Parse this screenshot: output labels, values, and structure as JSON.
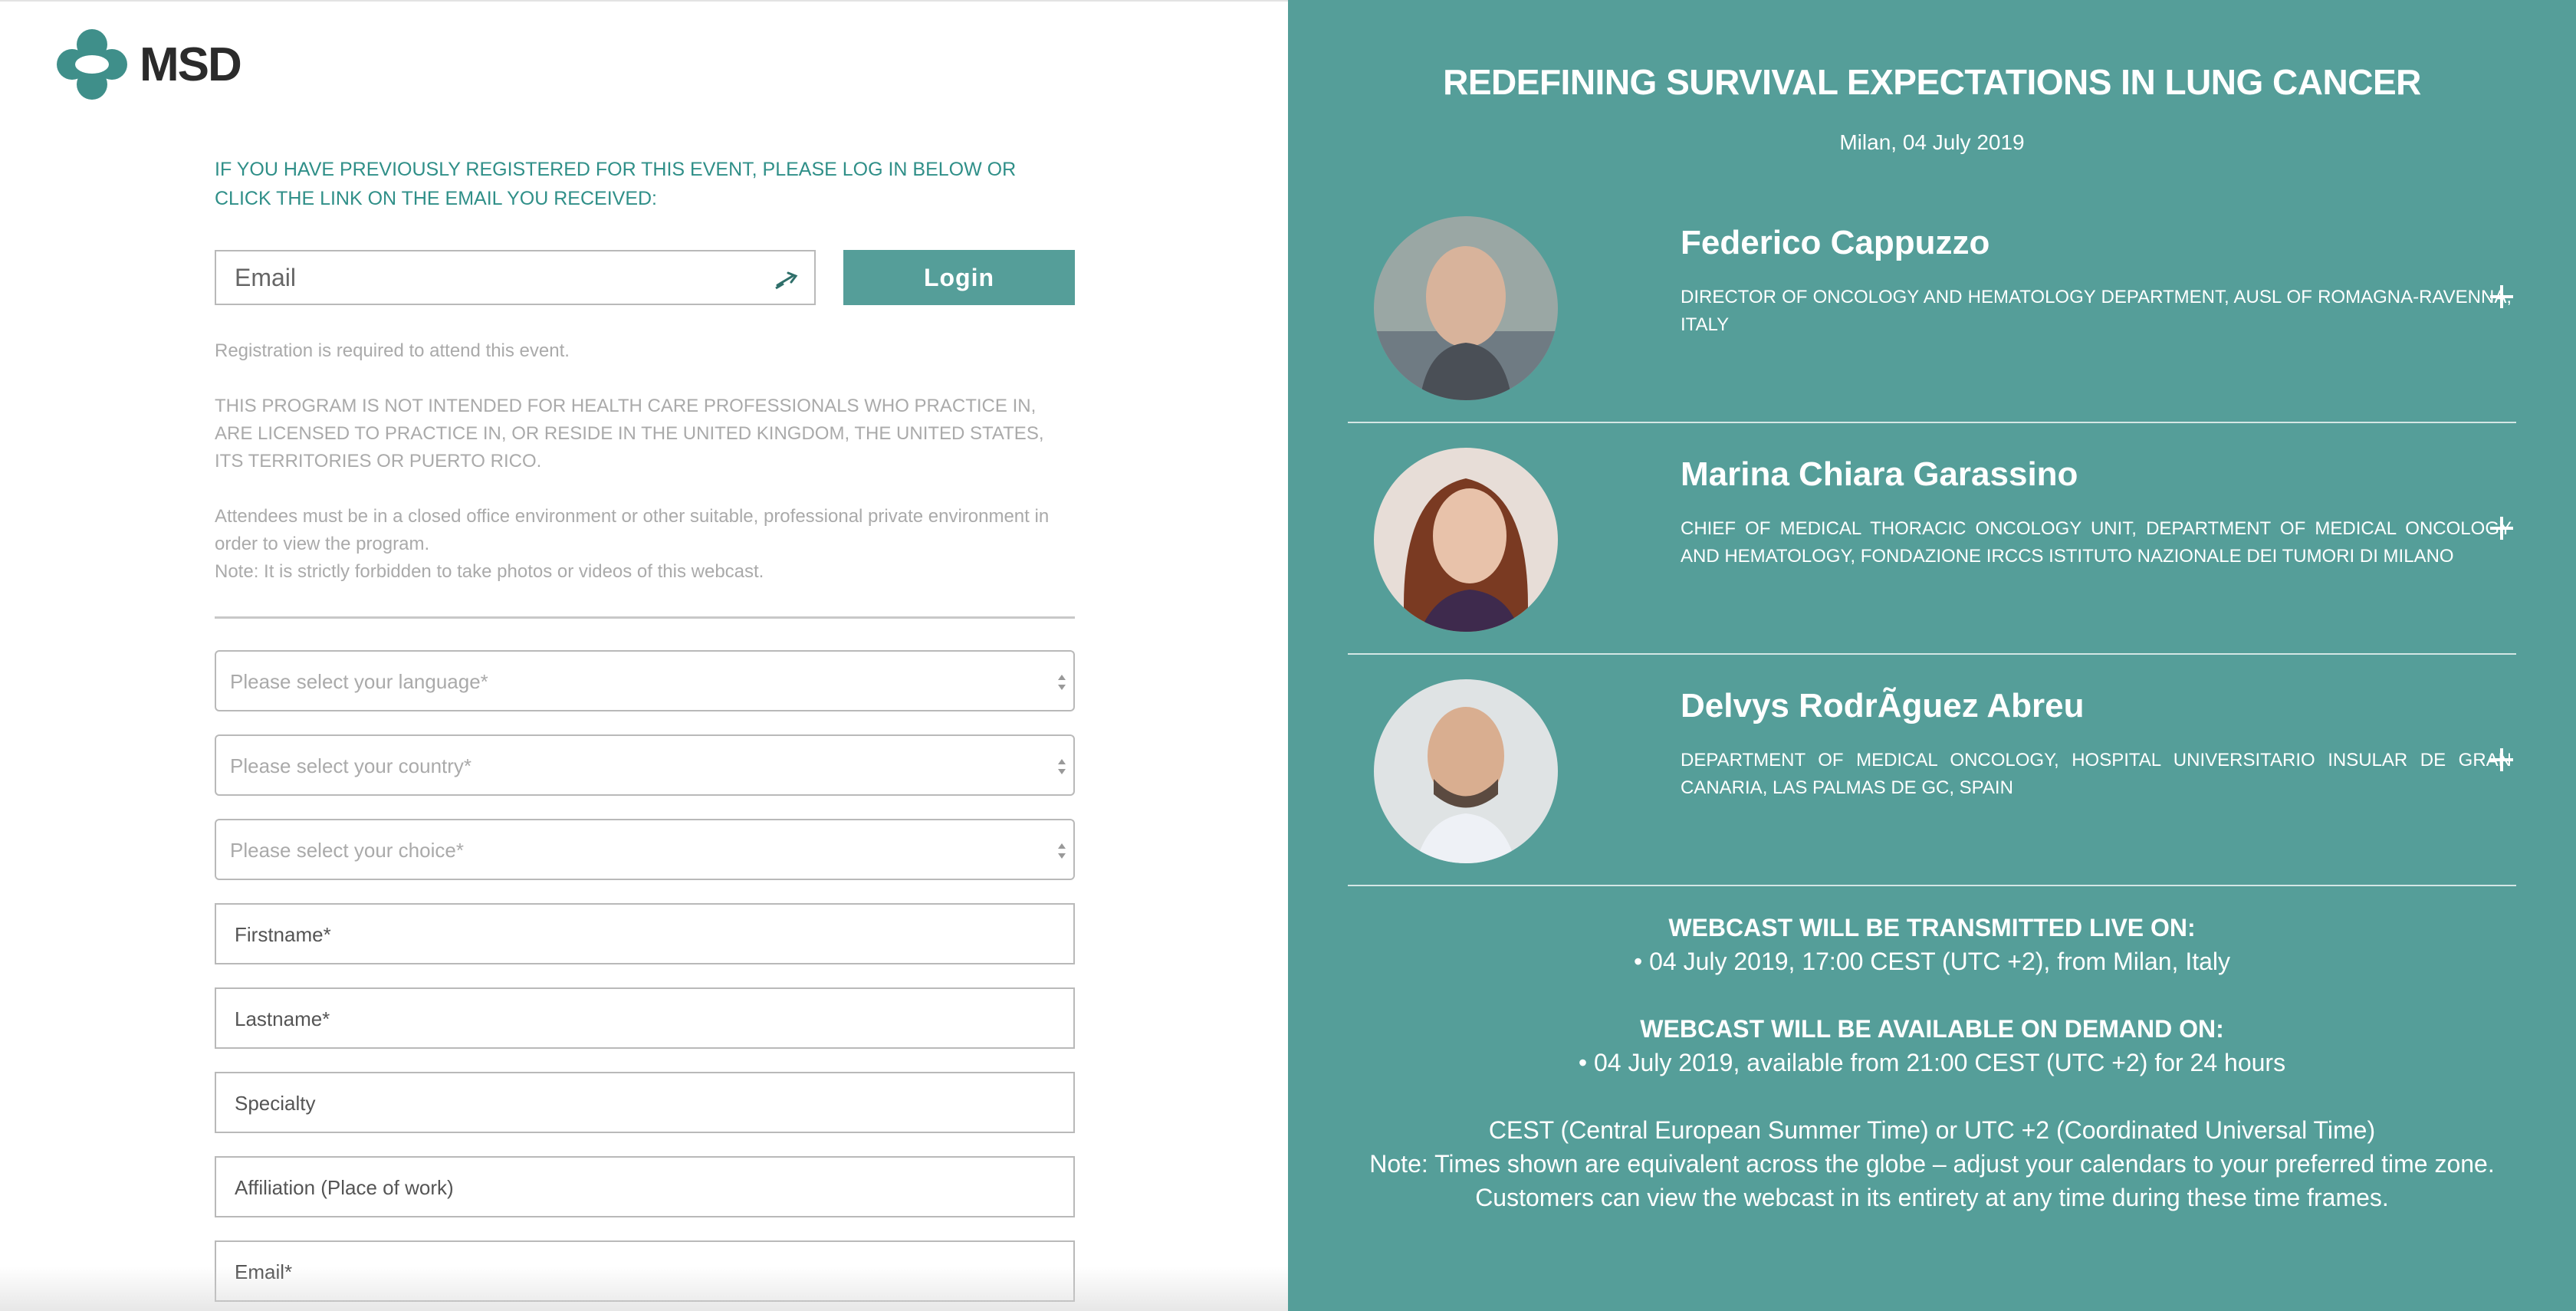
{
  "brand": {
    "name": "MSD"
  },
  "login": {
    "intro": "IF YOU HAVE PREVIOUSLY REGISTERED FOR THIS EVENT, PLEASE LOG IN BELOW OR CLICK THE LINK ON THE EMAIL YOU RECEIVED:",
    "email_placeholder": "Email",
    "button_label": "Login"
  },
  "notices": {
    "registration": "Registration is required to attend this event.",
    "program": "THIS PROGRAM IS NOT INTENDED FOR HEALTH CARE PROFESSIONALS WHO PRACTICE IN, ARE LICENSED TO PRACTICE IN, OR RESIDE IN THE UNITED KINGDOM, THE UNITED STATES, ITS TERRITORIES OR PUERTO RICO.",
    "attendees": "Attendees must be in a closed office environment or other suitable, professional private environment in order to view the program.",
    "photo_note": "Note: It is strictly forbidden to take photos or videos of this webcast."
  },
  "form": {
    "language": "Please select your language*",
    "country": "Please select your country*",
    "choice": "Please select your choice*",
    "firstname": "Firstname*",
    "lastname": "Lastname*",
    "specialty": "Specialty",
    "affiliation": "Affiliation (Place of work)",
    "email": "Email*"
  },
  "event": {
    "title": "REDEFINING SURVIVAL EXPECTATIONS IN LUNG CANCER",
    "location_date": "Milan, 04 July 2019",
    "speakers": [
      {
        "name": "Federico Cappuzzo",
        "role": "DIRECTOR OF ONCOLOGY AND HEMATOLOGY DEPARTMENT, AUSL OF ROMAGNA-RAVENNA, ITALY"
      },
      {
        "name": "Marina Chiara Garassino",
        "role": "CHIEF OF MEDICAL THORACIC ONCOLOGY UNIT, DEPARTMENT OF MEDICAL ONCOLOGY AND HEMATOLOGY, FONDAZIONE IRCCS ISTITUTO NAZIONALE DEI TUMORI DI MILANO"
      },
      {
        "name": "Delvys RodrÃguez Abreu",
        "role": "DEPARTMENT OF MEDICAL ONCOLOGY, HOSPITAL UNIVERSITARIO INSULAR DE GRAN CANARIA, LAS PALMAS DE GC, SPAIN"
      }
    ],
    "live_heading": "WEBCAST WILL BE TRANSMITTED LIVE ON:",
    "live_detail": "• 04 July 2019, 17:00 CEST (UTC +2), from Milan, Italy",
    "ondemand_heading": "WEBCAST WILL BE AVAILABLE ON DEMAND ON:",
    "ondemand_detail": "• 04 July 2019, available from 21:00 CEST (UTC +2) for 24 hours",
    "tz_line": "CEST (Central European Summer Time) or UTC +2 (Coordinated Universal Time)",
    "tz_note": "Note: Times shown are equivalent across the globe – adjust your calendars to your preferred time zone.",
    "tz_view": "Customers can view the webcast in its entirety at any time during these time frames."
  },
  "colors": {
    "teal": "#559e99",
    "teal_text": "#2f8f88",
    "gray_text": "#aaaaaa"
  }
}
